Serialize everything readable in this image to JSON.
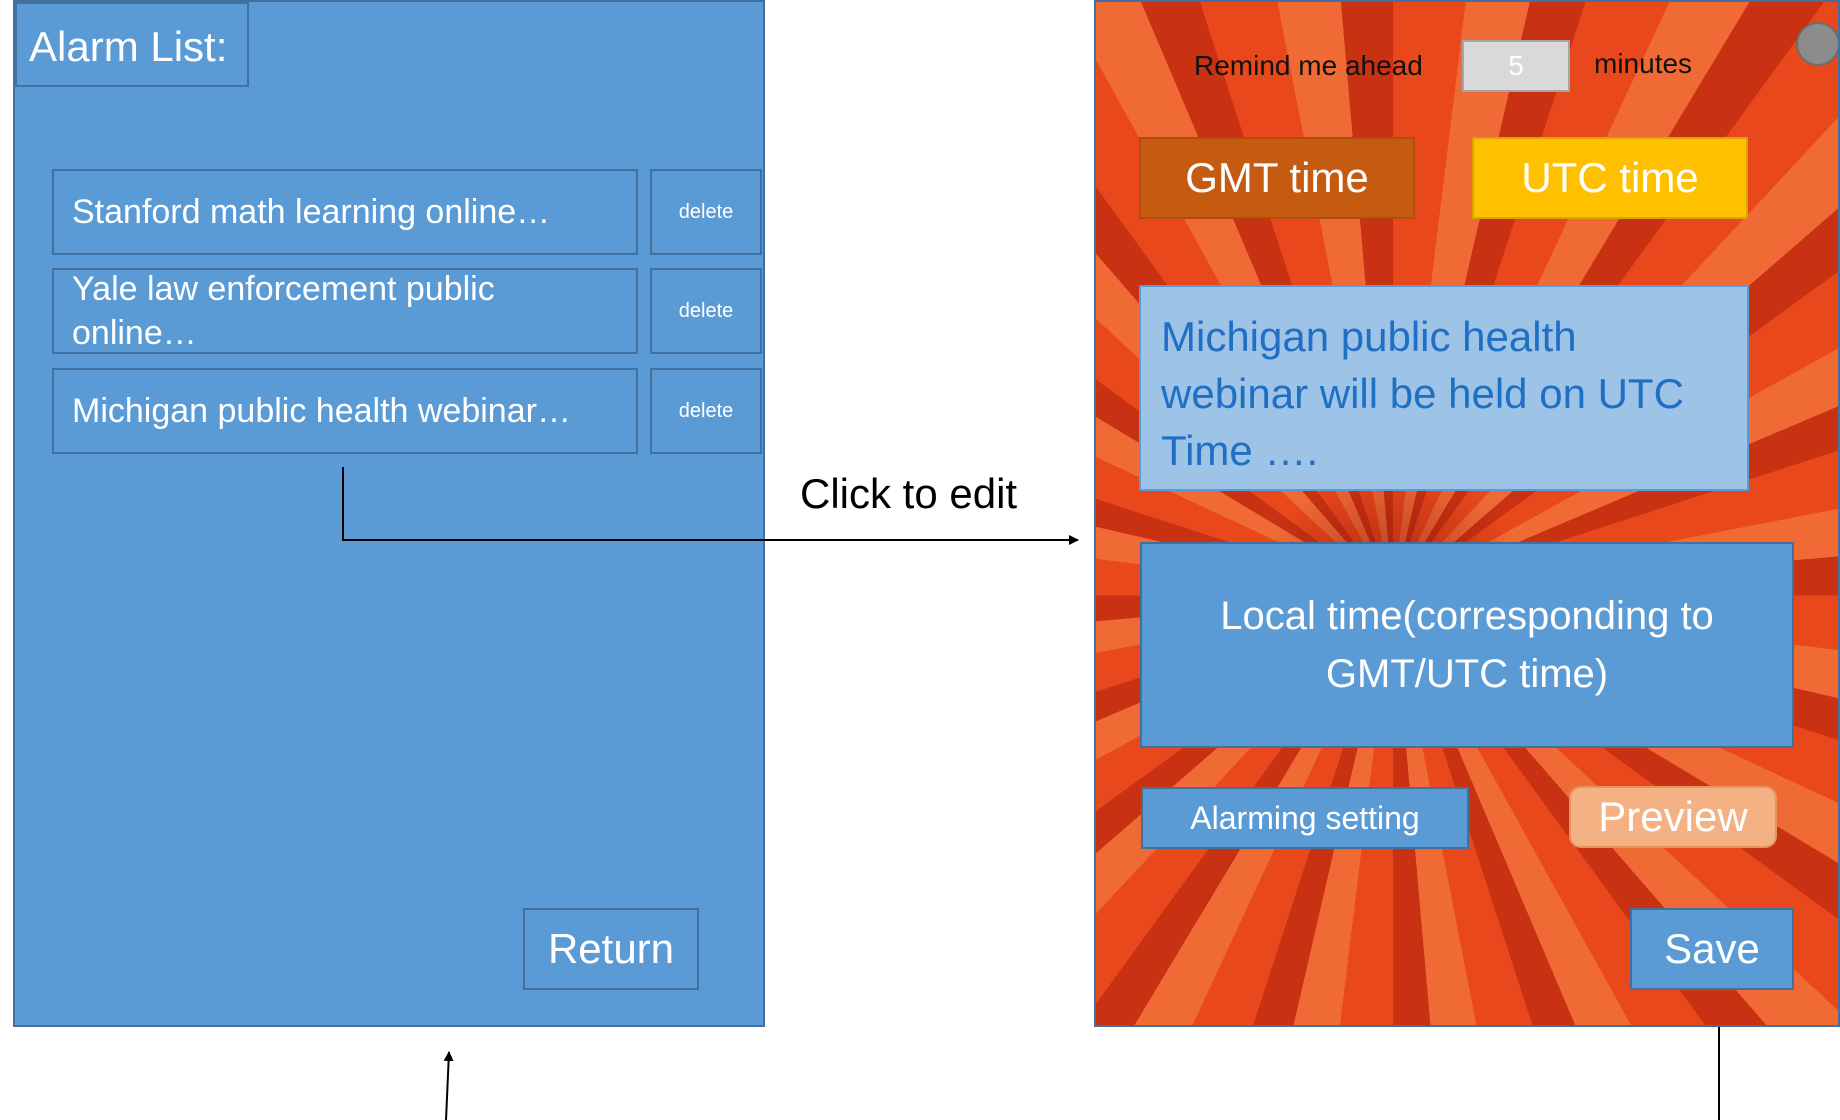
{
  "alarm_list": {
    "title": "Alarm List:",
    "items": [
      {
        "label": "Stanford math learning online…",
        "delete_label": "delete"
      },
      {
        "label": "Yale law enforcement public online…",
        "delete_label": "delete"
      },
      {
        "label": "Michigan public health webinar…",
        "delete_label": "delete"
      }
    ],
    "return_label": "Return"
  },
  "connector": {
    "label": "Click to edit"
  },
  "editor": {
    "remind_label": "Remind me ahead",
    "remind_value": "5",
    "minutes_label": "minutes",
    "gmt_label": "GMT time",
    "utc_label": "UTC time",
    "message": "Michigan public health webinar will be held on UTC Time ….",
    "local_time_label": "Local time(corresponding to GMT/UTC time)",
    "alarm_setting_label": "Alarming setting",
    "preview_label": "Preview",
    "save_label": "Save",
    "colors": {
      "panel_blue": "#5b9bd5",
      "gmt": "#c55a11",
      "utc": "#ffc000",
      "message_bg": "#9dc3e6",
      "preview": "#f4b183"
    }
  }
}
